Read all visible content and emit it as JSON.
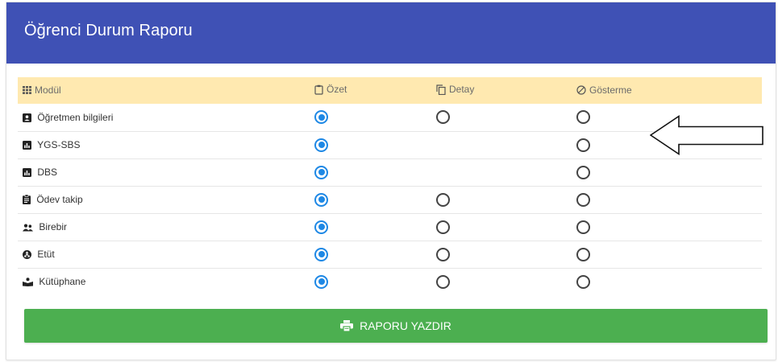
{
  "header": {
    "title": "Öğrenci Durum Raporu"
  },
  "table": {
    "columns": [
      {
        "label": "Modül",
        "icon": "grid-icon"
      },
      {
        "label": "Özet",
        "icon": "clipboard-icon"
      },
      {
        "label": "Detay",
        "icon": "copy-icon"
      },
      {
        "label": "Gösterme",
        "icon": "block-icon"
      }
    ],
    "rows": [
      {
        "label": "Öğretmen bilgileri",
        "icon": "contact-card-icon",
        "selected": "ozet",
        "has_detay": true
      },
      {
        "label": "YGS-SBS",
        "icon": "bar-chart-icon",
        "selected": "ozet",
        "has_detay": false
      },
      {
        "label": "DBS",
        "icon": "bar-chart-icon",
        "selected": "ozet",
        "has_detay": false
      },
      {
        "label": "Ödev takip",
        "icon": "clipboard-list-icon",
        "selected": "ozet",
        "has_detay": true
      },
      {
        "label": "Birebir",
        "icon": "people-icon",
        "selected": "ozet",
        "has_detay": true
      },
      {
        "label": "Etüt",
        "icon": "atom-icon",
        "selected": "ozet",
        "has_detay": true
      },
      {
        "label": "Kütüphane",
        "icon": "reader-icon",
        "selected": "ozet",
        "has_detay": true
      }
    ]
  },
  "print_button": {
    "label": "RAPORU YAZDIR",
    "icon": "printer-icon"
  },
  "annotation": {
    "icon": "left-arrow-icon"
  },
  "colors": {
    "header": "#3f51b5",
    "table_header": "#ffe9b0",
    "radio_checked": "#1e88e5",
    "button": "#4caf50"
  }
}
